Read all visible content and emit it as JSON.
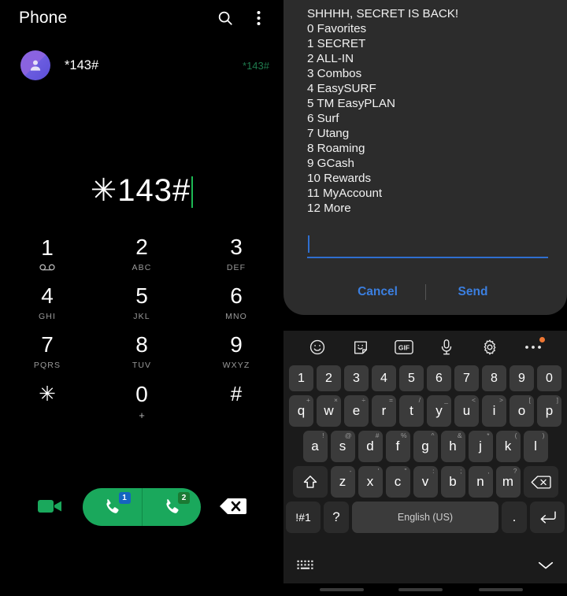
{
  "phone": {
    "title": "Phone",
    "search_icon": "search-icon",
    "overflow_icon": "overflow-menu-icon",
    "contact": {
      "name": "*143#",
      "sublabel": "*143#",
      "avatar_icon": "person-avatar-icon",
      "avatar_color": "#8a63e0",
      "sublabel_color": "#1f7a4d"
    },
    "dialed_number": "✳143#",
    "caret_color": "#1db954",
    "keypad": [
      {
        "digit": "1",
        "letters": "",
        "icon": "voicemail-icon"
      },
      {
        "digit": "2",
        "letters": "ABC",
        "icon": ""
      },
      {
        "digit": "3",
        "letters": "DEF",
        "icon": ""
      },
      {
        "digit": "4",
        "letters": "GHI",
        "icon": ""
      },
      {
        "digit": "5",
        "letters": "JKL",
        "icon": ""
      },
      {
        "digit": "6",
        "letters": "MNO",
        "icon": ""
      },
      {
        "digit": "7",
        "letters": "PQRS",
        "icon": ""
      },
      {
        "digit": "8",
        "letters": "TUV",
        "icon": ""
      },
      {
        "digit": "9",
        "letters": "WXYZ",
        "icon": ""
      },
      {
        "digit": "✳",
        "letters": "",
        "icon": ""
      },
      {
        "digit": "0",
        "letters": "+",
        "icon": ""
      },
      {
        "digit": "#",
        "letters": "",
        "icon": ""
      }
    ],
    "actions": {
      "video_call_icon": "video-camera-icon",
      "call_sim1_icon": "phone-handset-icon",
      "call_sim1_badge": "1",
      "call_sim2_icon": "phone-handset-icon",
      "call_sim2_badge": "2",
      "backspace_icon": "backspace-icon",
      "call_button_color": "#1aa85c",
      "sim1_badge_color": "#1565c0",
      "sim2_badge_color": "#1b7a33"
    }
  },
  "ussd": {
    "lines": [
      "SHHHH, SECRET IS BACK!",
      "0 Favorites",
      "1 SECRET",
      "2 ALL-IN",
      "3 Combos",
      "4 EasySURF",
      "5 TM EasyPLAN",
      "6 Surf",
      "7 Utang",
      "8 Roaming",
      "9 GCash",
      "10 Rewards",
      "11 MyAccount",
      "12 More"
    ],
    "input_value": "",
    "input_placeholder": "",
    "cancel_label": "Cancel",
    "send_label": "Send",
    "accent_color": "#3b7fe0"
  },
  "keyboard": {
    "toolbar": [
      {
        "icon": "emoji-smiley-icon",
        "badge": false
      },
      {
        "icon": "sticker-icon",
        "badge": false
      },
      {
        "icon": "gif-icon",
        "badge": false
      },
      {
        "icon": "microphone-icon",
        "badge": false
      },
      {
        "icon": "settings-gear-icon",
        "badge": false
      },
      {
        "icon": "more-options-icon",
        "badge": true
      }
    ],
    "badge_color": "#ee7733",
    "row_numbers": [
      "1",
      "2",
      "3",
      "4",
      "5",
      "6",
      "7",
      "8",
      "9",
      "0"
    ],
    "row_q": [
      {
        "key": "q",
        "sup": "+"
      },
      {
        "key": "w",
        "sup": "×"
      },
      {
        "key": "e",
        "sup": "÷"
      },
      {
        "key": "r",
        "sup": "="
      },
      {
        "key": "t",
        "sup": "/"
      },
      {
        "key": "y",
        "sup": "_"
      },
      {
        "key": "u",
        "sup": "<"
      },
      {
        "key": "i",
        "sup": ">"
      },
      {
        "key": "o",
        "sup": "["
      },
      {
        "key": "p",
        "sup": "]"
      }
    ],
    "row_a": [
      {
        "key": "a",
        "sup": "!"
      },
      {
        "key": "s",
        "sup": "@"
      },
      {
        "key": "d",
        "sup": "#"
      },
      {
        "key": "f",
        "sup": "%"
      },
      {
        "key": "g",
        "sup": "^"
      },
      {
        "key": "h",
        "sup": "&"
      },
      {
        "key": "j",
        "sup": "*"
      },
      {
        "key": "k",
        "sup": "("
      },
      {
        "key": "l",
        "sup": ")"
      }
    ],
    "row_z": [
      {
        "key": "z",
        "sup": "-"
      },
      {
        "key": "x",
        "sup": "'"
      },
      {
        "key": "c",
        "sup": "\""
      },
      {
        "key": "v",
        "sup": ":"
      },
      {
        "key": "b",
        "sup": ";"
      },
      {
        "key": "n",
        "sup": ","
      },
      {
        "key": "m",
        "sup": "?"
      }
    ],
    "shift_icon": "shift-up-arrow-icon",
    "backspace_icon": "backspace-icon",
    "symbols_label": "!#1",
    "question_label": "?",
    "space_label": "English (US)",
    "period_label": ".",
    "enter_icon": "enter-return-icon",
    "layout_icon": "keyboard-layout-icon",
    "hide_icon": "chevron-down-icon"
  }
}
